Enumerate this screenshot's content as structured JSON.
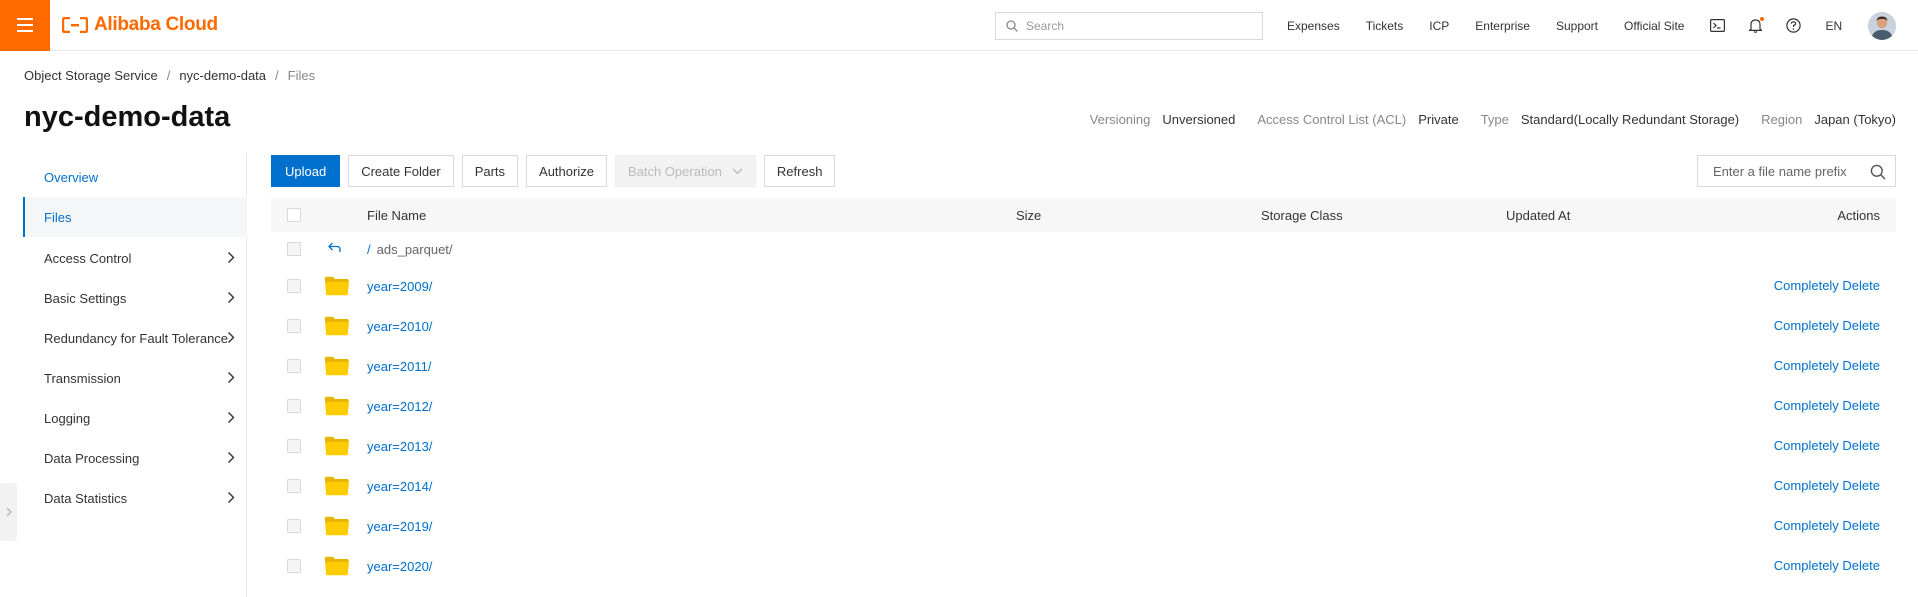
{
  "brand": {
    "logo_text": "Alibaba Cloud",
    "accent": "#ff6a00",
    "link_color": "#0070cc"
  },
  "header": {
    "search_placeholder": "Search",
    "nav": [
      "Expenses",
      "Tickets",
      "ICP",
      "Enterprise",
      "Support",
      "Official Site"
    ],
    "icons": [
      "terminal-icon",
      "bell-icon",
      "help-icon"
    ],
    "language": "EN"
  },
  "breadcrumb": [
    "Object Storage Service",
    "nyc-demo-data",
    "Files"
  ],
  "page": {
    "title": "nyc-demo-data",
    "meta": [
      {
        "key": "Versioning",
        "value": "Unversioned"
      },
      {
        "key": "Access Control List (ACL)",
        "value": "Private"
      },
      {
        "key": "Type",
        "value": "Standard(Locally Redundant Storage)"
      },
      {
        "key": "Region",
        "value": "Japan (Tokyo)"
      }
    ]
  },
  "sidebar": {
    "items": [
      {
        "label": "Overview",
        "state": "link"
      },
      {
        "label": "Files",
        "state": "active"
      },
      {
        "label": "Access Control",
        "state": "expandable"
      },
      {
        "label": "Basic Settings",
        "state": "expandable"
      },
      {
        "label": "Redundancy for Fault Tolerance",
        "state": "expandable"
      },
      {
        "label": "Transmission",
        "state": "expandable"
      },
      {
        "label": "Logging",
        "state": "expandable"
      },
      {
        "label": "Data Processing",
        "state": "expandable"
      },
      {
        "label": "Data Statistics",
        "state": "expandable"
      }
    ]
  },
  "toolbar": {
    "upload": "Upload",
    "create_folder": "Create Folder",
    "parts": "Parts",
    "authorize": "Authorize",
    "batch_operation": "Batch Operation",
    "refresh": "Refresh",
    "prefix_placeholder": "Enter a file name prefix"
  },
  "table": {
    "columns": {
      "name": "File Name",
      "size": "Size",
      "storage_class": "Storage Class",
      "updated_at": "Updated At",
      "actions": "Actions"
    },
    "path_root": "/",
    "current_path": "ads_parquet/",
    "rows": [
      {
        "name": "year=2009/",
        "action": "Completely Delete"
      },
      {
        "name": "year=2010/",
        "action": "Completely Delete"
      },
      {
        "name": "year=2011/",
        "action": "Completely Delete"
      },
      {
        "name": "year=2012/",
        "action": "Completely Delete"
      },
      {
        "name": "year=2013/",
        "action": "Completely Delete"
      },
      {
        "name": "year=2014/",
        "action": "Completely Delete"
      },
      {
        "name": "year=2019/",
        "action": "Completely Delete"
      },
      {
        "name": "year=2020/",
        "action": "Completely Delete"
      }
    ]
  }
}
